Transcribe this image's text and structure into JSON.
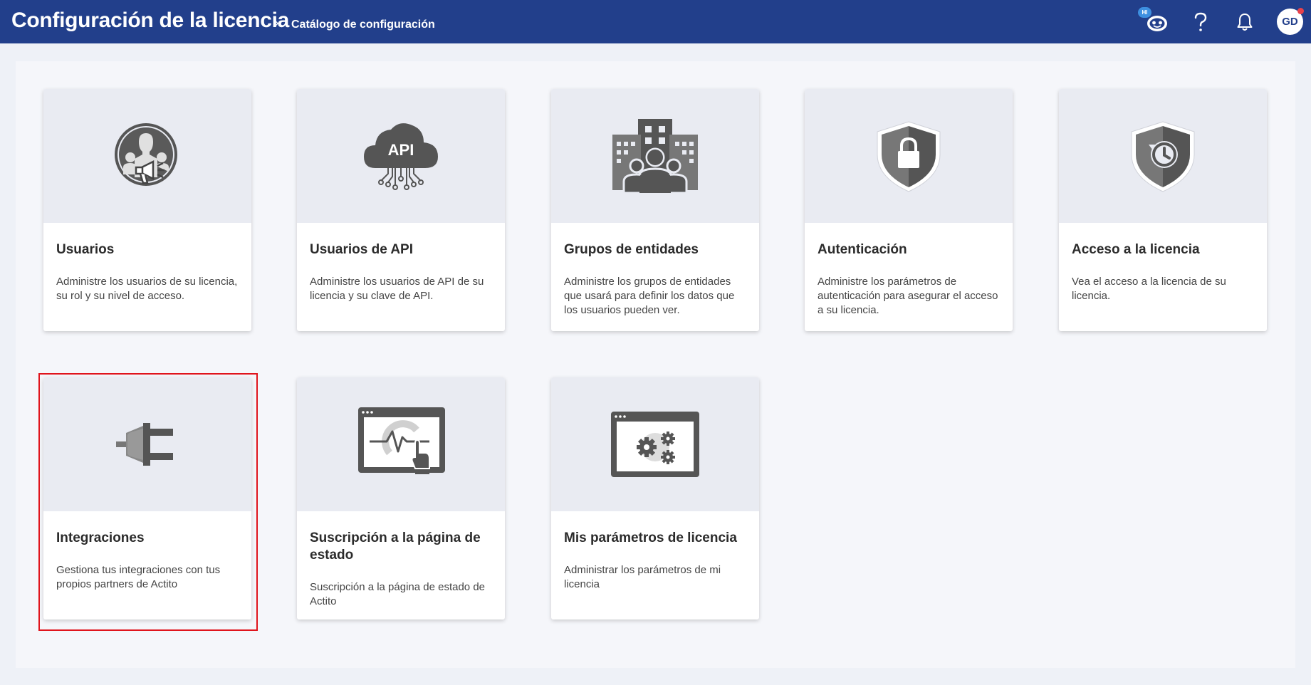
{
  "header": {
    "title": "Configuración de la licencia",
    "breadcrumb_sep": "›",
    "breadcrumb": "Catálogo de configuración",
    "bot_badge": "HI",
    "avatar_initials": "GD"
  },
  "cards": [
    {
      "title": "Usuarios",
      "desc": "Administre los usuarios de su licencia, su rol y su nivel de acceso.",
      "icon": "users-icon"
    },
    {
      "title": "Usuarios de API",
      "desc": "Administre los usuarios de API de su licencia y su clave de API.",
      "icon": "api-cloud-icon"
    },
    {
      "title": "Grupos de entidades",
      "desc": "Administre los grupos de entidades que usará para definir los datos que los usuarios pueden ver.",
      "icon": "entity-groups-icon"
    },
    {
      "title": "Autenticación",
      "desc": "Administre los parámetros de autenticación para asegurar el acceso a su licencia.",
      "icon": "shield-lock-icon"
    },
    {
      "title": "Acceso a la licencia",
      "desc": "Vea el acceso a la licencia de su licencia.",
      "icon": "shield-history-icon"
    },
    {
      "title": "Integraciones",
      "desc": "Gestiona tus integraciones con tus propios partners de Actito",
      "icon": "plug-icon"
    },
    {
      "title": "Suscripción a la página de estado",
      "desc": "Suscripción a la página de estado de Actito",
      "icon": "status-monitor-icon"
    },
    {
      "title": "Mis parámetros de licencia",
      "desc": "Administrar los parámetros de mi licencia",
      "icon": "settings-window-icon"
    }
  ]
}
